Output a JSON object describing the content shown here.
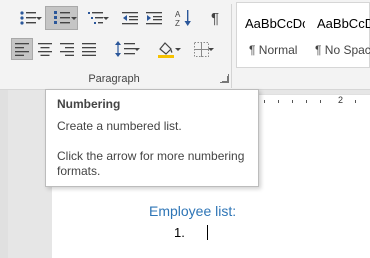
{
  "ribbon": {
    "group_label": "Paragraph",
    "styles": [
      {
        "sample": "AaBbCcDc",
        "name": "¶ Normal"
      },
      {
        "sample": "AaBbCcD",
        "name": "¶ No Spac..."
      }
    ]
  },
  "ruler": {
    "number": "2"
  },
  "document": {
    "heading": "Employee list:",
    "list_number": "1."
  },
  "tooltip": {
    "title": "Numbering",
    "line1": "Create a numbered list.",
    "line2": "Click the arrow for more numbering",
    "line3": "formats."
  },
  "colors": {
    "accent_heading": "#2e75b6",
    "active_button": "#c5c5c5"
  }
}
